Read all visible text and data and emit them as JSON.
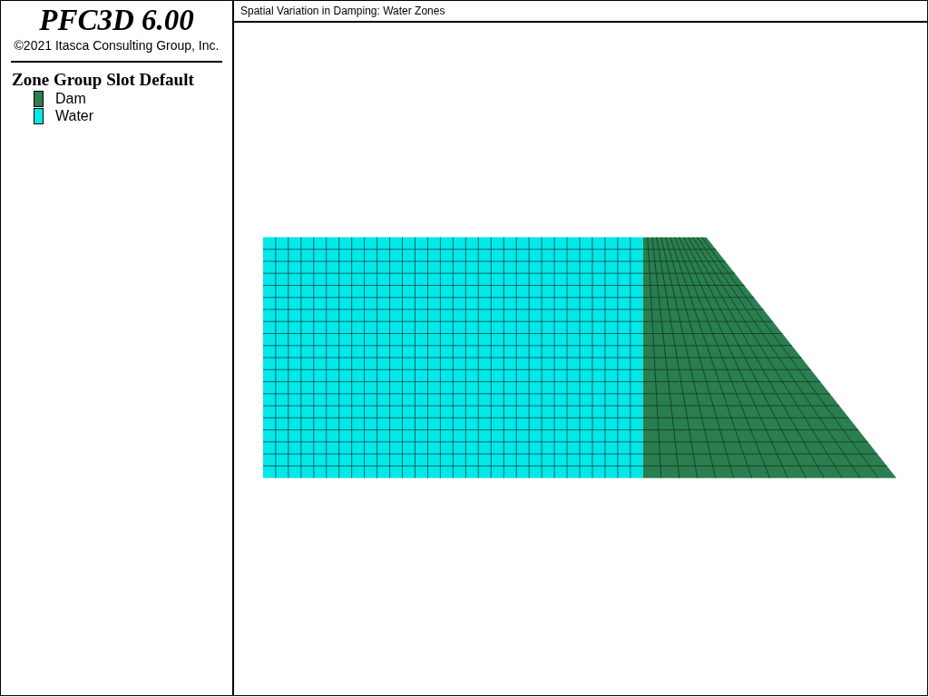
{
  "sidebar": {
    "title": "PFC3D 6.00",
    "copyright": "©2021 Itasca Consulting Group, Inc.",
    "legend": {
      "title": "Zone Group Slot Default",
      "items": [
        {
          "label": "Dam",
          "color": "#2a7e4f"
        },
        {
          "label": "Water",
          "color": "#03e8e8"
        }
      ]
    }
  },
  "plot": {
    "title": "Spatial Variation in Damping: Water Zones"
  }
}
